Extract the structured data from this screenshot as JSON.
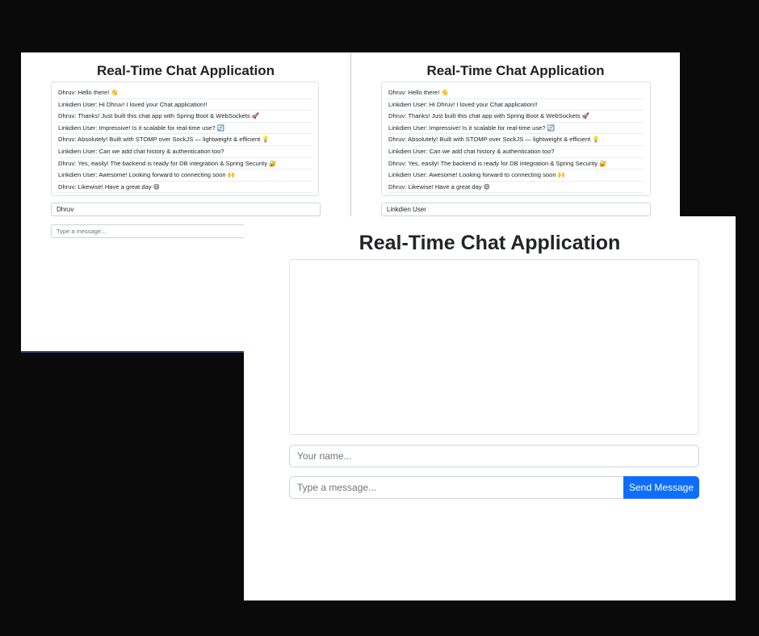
{
  "left_window": {
    "title": "Real-Time Chat Application",
    "messages": [
      "Dhruv: Hello there! 👋",
      "Linkdien User: Hi Dhruv! I loved your Chat application!!",
      "Dhruv: Thanks! Just built this chat app with Spring Boot & WebSockets 🚀",
      "Linkdien User: Impressive! Is it scalable for real-time use? 🔄",
      "Dhruv: Absolutely! Built with STOMP over SockJS — lightweight & efficient 💡",
      "Linkdien User: Can we add chat history & authentication too?",
      "Dhruv: Yes, easily! The backend is ready for DB integration & Spring Security 🔐",
      "Linkdien User: Awesome! Looking forward to connecting soon 🙌",
      "Dhruv: Likewise! Have a great day 😄"
    ],
    "name_value": "Dhruv",
    "message_placeholder": "Type a message..."
  },
  "right_window": {
    "title": "Real-Time Chat Application",
    "messages": [
      "Dhruv: Hello there! 👋",
      "Linkdien User: Hi Dhruv! I loved your Chat application!!",
      "Dhruv: Thanks! Just built this chat app with Spring Boot & WebSockets 🚀",
      "Linkdien User: Impressive! Is it scalable for real-time use? 🔄",
      "Dhruv: Absolutely! Built with STOMP over SockJS — lightweight & efficient 💡",
      "Linkdien User: Can we add chat history & authentication too?",
      "Dhruv: Yes, easily! The backend is ready for DB integration & Spring Security 🔐",
      "Linkdien User: Awesome! Looking forward to connecting soon 🙌",
      "Dhruv: Likewise! Have a great day 😄"
    ],
    "name_value": "Linkdien User"
  },
  "front_window": {
    "title": "Real-Time Chat Application",
    "name_placeholder": "Your name...",
    "message_placeholder": "Type a message...",
    "send_label": "Send Message"
  },
  "colors": {
    "background": "#0a0a0a",
    "send_button": "#0d6efd"
  }
}
